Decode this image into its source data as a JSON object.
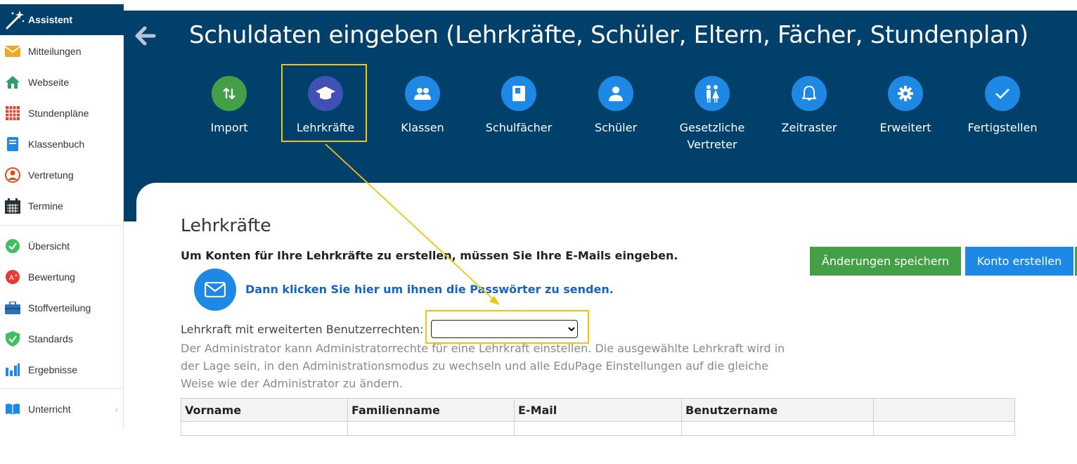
{
  "sidebar": {
    "top_label": "Assistent",
    "items": [
      {
        "label": "Mitteilungen",
        "icon": "envelope-icon"
      },
      {
        "label": "Webseite",
        "icon": "house-icon"
      },
      {
        "label": "Stundenpläne",
        "icon": "timetable-grid-icon"
      },
      {
        "label": "Klassenbuch",
        "icon": "book-icon"
      },
      {
        "label": "Vertretung",
        "icon": "person-swap-icon"
      },
      {
        "label": "Termine",
        "icon": "calendar-icon"
      },
      {
        "label": "Übersicht",
        "icon": "check-circle-icon"
      },
      {
        "label": "Bewertung",
        "icon": "grade-icon"
      },
      {
        "label": "Stoffverteilung",
        "icon": "briefcase-icon"
      },
      {
        "label": "Standards",
        "icon": "shield-check-icon"
      },
      {
        "label": "Ergebnisse",
        "icon": "bar-chart-icon"
      },
      {
        "label": "Unterricht",
        "icon": "open-book-icon"
      }
    ]
  },
  "header": {
    "title": "Schuldaten eingeben (Lehrkräfte, Schüler, Eltern, Fächer, Stundenplan)"
  },
  "steps": [
    {
      "label": "Import",
      "color": "#43a047"
    },
    {
      "label": "Lehrkräfte",
      "color": "#3f51b5"
    },
    {
      "label": "Klassen",
      "color": "#1e88e5"
    },
    {
      "label": "Schulfächer",
      "color": "#1e88e5"
    },
    {
      "label": "Schüler",
      "color": "#1e88e5"
    },
    {
      "label": "Gesetzliche Vertreter",
      "color": "#1e88e5"
    },
    {
      "label": "Zeitraster",
      "color": "#1e88e5"
    },
    {
      "label": "Erweitert",
      "color": "#1e88e5"
    },
    {
      "label": "Fertigstellen",
      "color": "#1e88e5"
    }
  ],
  "content": {
    "heading": "Lehrkräfte",
    "lead": "Um Konten für Ihre Lehrkräfte zu erstellen, müssen Sie Ihre E-Mails eingeben.",
    "mail_link": "Dann klicken Sie hier um ihnen die Passwörter zu senden.",
    "save_button": "Änderungen speichern",
    "account_button": "Konto erstellen",
    "admin_label": "Lehrkraft mit erweiterten Benutzerrechten:",
    "admin_select_value": "",
    "description": "Der Administrator kann Administratorrechte für eine Lehrkraft einstellen. Die ausgewählte Lehrkraft wird in der Lage sein, in den Administrationsmodus zu wechseln und alle EduPage Einstellungen auf die gleiche Weise wie der Administrator zu ändern.",
    "table_headers": [
      "Vorname",
      "Familienname",
      "E-Mail",
      "Benutzername",
      ""
    ]
  },
  "colors": {
    "header_bg": "#00406b",
    "accent_blue": "#1e88e5",
    "accent_green": "#43a047",
    "highlight": "#f1c40f",
    "link": "#1565c0"
  }
}
